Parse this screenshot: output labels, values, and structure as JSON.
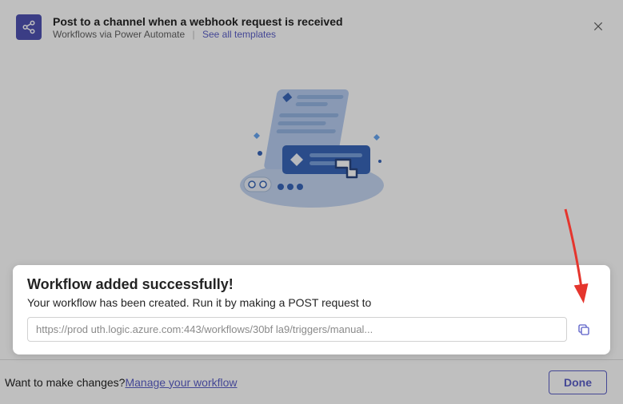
{
  "header": {
    "title": "Post to a channel when a webhook request is received",
    "subtitle": "Workflows via Power Automate",
    "see_all": "See all templates"
  },
  "success": {
    "title": "Workflow added successfully!",
    "desc": "Your workflow has been created. Run it by making a POST request to",
    "url": "https://prod           uth.logic.azure.com:443/workflows/30bf                                                       la9/triggers/manual..."
  },
  "bottom": {
    "prompt": "Want to make changes? ",
    "manage": "Manage your workflow",
    "done": "Done"
  }
}
